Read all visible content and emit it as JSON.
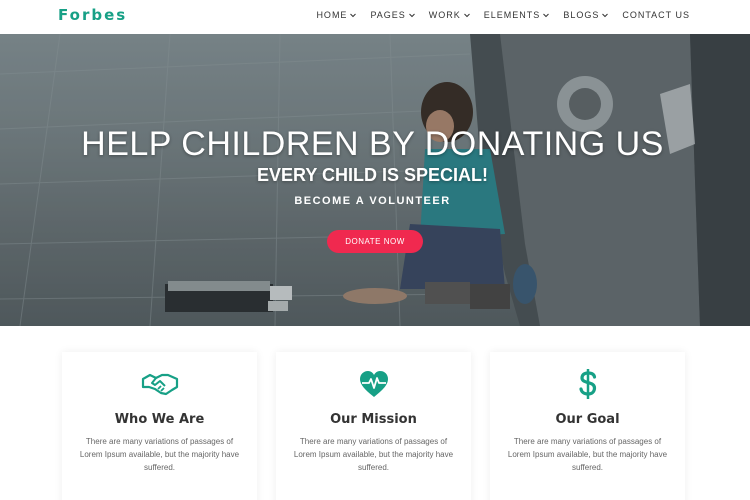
{
  "header": {
    "logo": "Forbes",
    "nav": [
      {
        "label": "HOME",
        "dropdown": true
      },
      {
        "label": "PAGES",
        "dropdown": true
      },
      {
        "label": "WORK",
        "dropdown": true
      },
      {
        "label": "ELEMENTS",
        "dropdown": true
      },
      {
        "label": "BLOGS",
        "dropdown": true
      },
      {
        "label": "CONTACT US",
        "dropdown": false
      }
    ]
  },
  "hero": {
    "title": "HELP CHILDREN BY DONATING US",
    "subtitle": "EVERY CHILD IS SPECIAL!",
    "tagline": "BECOME A VOLUNTEER",
    "cta": "DONATE NOW"
  },
  "features": [
    {
      "icon": "handshake-icon",
      "title": "Who We Are",
      "text": "There are many variations of passages of Lorem Ipsum available, but the majority have suffered."
    },
    {
      "icon": "heartbeat-icon",
      "title": "Our Mission",
      "text": "There are many variations of passages of Lorem Ipsum available, but the majority have suffered."
    },
    {
      "icon": "dollar-icon",
      "title": "Our Goal",
      "text": "There are many variations of passages of Lorem Ipsum available, but the majority have suffered."
    }
  ],
  "colors": {
    "brand": "#17a086",
    "cta": "#f0294f",
    "text": "#333333",
    "muted": "#666666"
  }
}
